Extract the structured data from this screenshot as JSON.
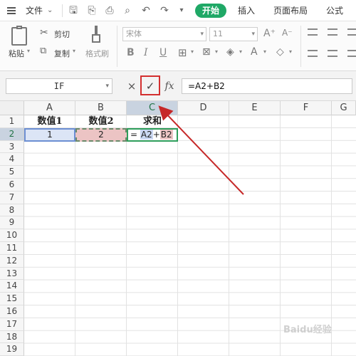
{
  "menubar": {
    "file_label": "文件",
    "tabs": [
      "开始",
      "插入",
      "页面布局",
      "公式"
    ]
  },
  "ribbon": {
    "paste": "粘贴",
    "cut": "剪切",
    "copy": "复制",
    "format_painter": "格式刷",
    "font_name": "宋体",
    "font_size": "11"
  },
  "formula_bar": {
    "name_box": "IF",
    "cancel_symbol": "×",
    "confirm_symbol": "✓",
    "fx_label": "fx",
    "formula": "=A2+B2"
  },
  "sheet": {
    "columns": [
      "A",
      "B",
      "C",
      "D",
      "E",
      "F",
      "G"
    ],
    "rows": [
      "1",
      "2",
      "3",
      "4",
      "5",
      "6",
      "7",
      "8",
      "9",
      "10",
      "11",
      "12",
      "13",
      "14",
      "15",
      "16",
      "17",
      "18",
      "19"
    ],
    "headers": {
      "a1": "数值1",
      "b1": "数值2",
      "c1": "求和"
    },
    "values": {
      "a2": "1",
      "b2": "2"
    },
    "c2_formula": {
      "eq": "=",
      "ref_a": "A2",
      "plus": "+",
      "ref_b": "B2"
    }
  },
  "annotation": {
    "arrow_color": "#c62828",
    "highlight_color": "#d32f2f"
  },
  "accent_color": "#1fa866"
}
